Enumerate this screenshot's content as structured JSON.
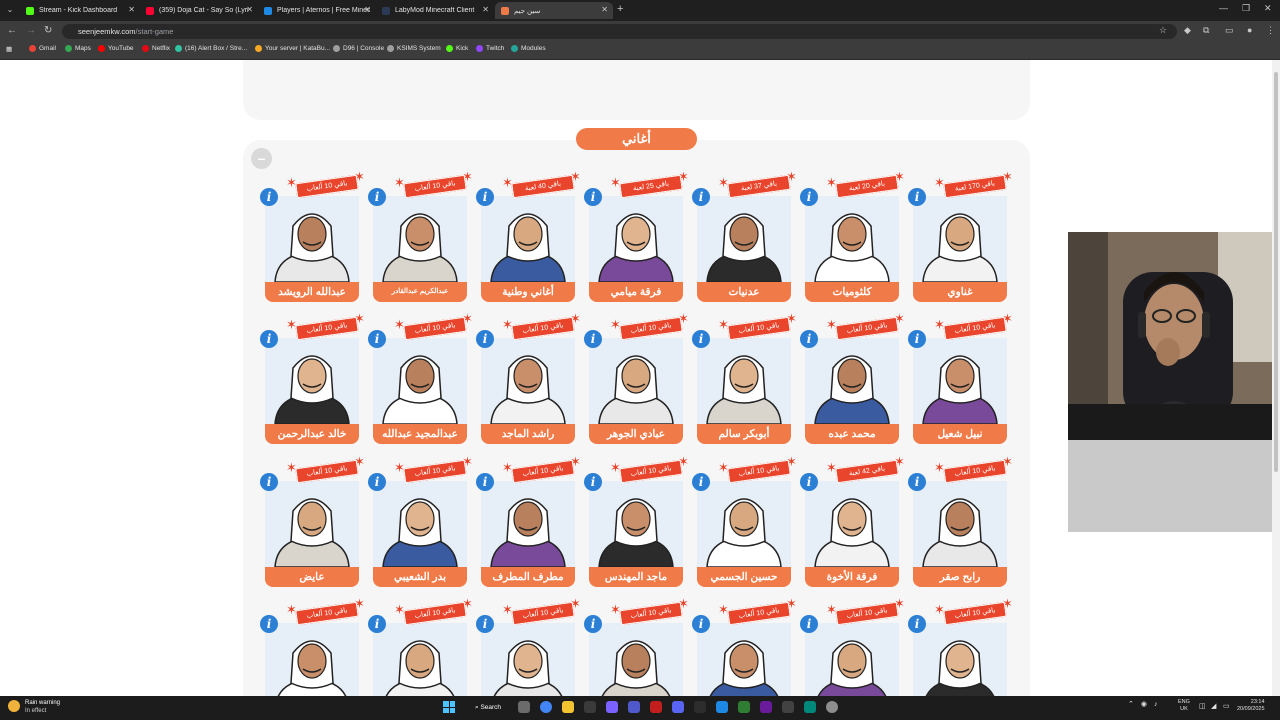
{
  "browser": {
    "tabs": [
      {
        "title": "Stream - Kick Dashboard",
        "fav_color": "#53fc18"
      },
      {
        "title": "(359) Doja Cat - Say So (Lyri",
        "fav_color": "#ff0033"
      },
      {
        "title": "Players | Aternos | Free Minecra",
        "fav_color": "#1e88e5"
      },
      {
        "title": "LabyMod Minecraft Client",
        "fav_color": "#2a3a55"
      },
      {
        "title": "سين جيم",
        "fav_color": "#f07a48"
      }
    ],
    "url_host": "seenjeemkw.com",
    "url_path": "/start-game",
    "bookmarks": [
      {
        "label": "Gmail",
        "color": "#ea4335"
      },
      {
        "label": "Maps",
        "color": "#34a853"
      },
      {
        "label": "YouTube",
        "color": "#ff0000"
      },
      {
        "label": "Netflix",
        "color": "#e50914"
      },
      {
        "label": "(16) Alert Box / Stre...",
        "color": "#31c3a2"
      },
      {
        "label": "Your server | KataBu...",
        "color": "#f9a825"
      },
      {
        "label": "D96 | Console",
        "color": "#9e9e9e"
      },
      {
        "label": "KSIMS System",
        "color": "#9e9e9e"
      },
      {
        "label": "Kick",
        "color": "#53fc18"
      },
      {
        "label": "Twitch",
        "color": "#9146ff"
      },
      {
        "label": "Modules",
        "color": "#26a69a"
      }
    ]
  },
  "page": {
    "section_title": "أغاني",
    "accent_color": "#f07a48",
    "ribbon_color": "#e8452c",
    "info_color": "#2b7fd4",
    "rows": [
      [
        {
          "name": "غناوي",
          "remaining": "باقي 170 لعبة"
        },
        {
          "name": "كلثوميات",
          "remaining": "باقي 20 لعبة"
        },
        {
          "name": "عدنيات",
          "remaining": "باقي 37 لعبة"
        },
        {
          "name": "فرقة ميامي",
          "remaining": "باقي 25 لعبة"
        },
        {
          "name": "أغاني وطنية",
          "remaining": "باقي 40 لعبة"
        },
        {
          "name": "عبدالكريم عبدالقادر",
          "remaining": "باقي 10 ألعاب",
          "small": true
        },
        {
          "name": "عبدالله الرويشد",
          "remaining": "باقي 10 ألعاب"
        }
      ],
      [
        {
          "name": "نبيل شعيل",
          "remaining": "باقي 10 ألعاب"
        },
        {
          "name": "محمد عبده",
          "remaining": "باقي 10 ألعاب"
        },
        {
          "name": "أبوبكر سالم",
          "remaining": "باقي 10 ألعاب"
        },
        {
          "name": "عبادي الجوهر",
          "remaining": "باقي 10 ألعاب"
        },
        {
          "name": "راشد الماجد",
          "remaining": "باقي 10 ألعاب"
        },
        {
          "name": "عبدالمجيد عبدالله",
          "remaining": "باقي 10 ألعاب"
        },
        {
          "name": "خالد عبدالرحمن",
          "remaining": "باقي 10 ألعاب"
        }
      ],
      [
        {
          "name": "رابح صقر",
          "remaining": "باقي 10 ألعاب"
        },
        {
          "name": "فرقة الأخوة",
          "remaining": "باقي 42 لعبة"
        },
        {
          "name": "حسين الجسمي",
          "remaining": "باقي 10 ألعاب"
        },
        {
          "name": "ماجد المهندس",
          "remaining": "باقي 10 ألعاب"
        },
        {
          "name": "مطرف المطرف",
          "remaining": "باقي 10 ألعاب"
        },
        {
          "name": "بدر الشعيبي",
          "remaining": "باقي 10 ألعاب"
        },
        {
          "name": "عايض",
          "remaining": "باقي 10 ألعاب"
        }
      ],
      [
        {
          "name": "",
          "remaining": "باقي 10 ألعاب"
        },
        {
          "name": "",
          "remaining": "باقي 10 ألعاب"
        },
        {
          "name": "",
          "remaining": "باقي 10 ألعاب"
        },
        {
          "name": "",
          "remaining": "باقي 10 ألعاب"
        },
        {
          "name": "",
          "remaining": "باقي 10 ألعاب"
        },
        {
          "name": "",
          "remaining": "باقي 10 ألعاب"
        },
        {
          "name": "",
          "remaining": "باقي 10 ألعاب"
        }
      ]
    ]
  },
  "taskbar": {
    "weather_title": "Rain warning",
    "weather_sub": "In effect",
    "search_label": "Search",
    "lang_top": "ENG",
    "lang_bottom": "UK",
    "time": "23:14",
    "date": "20/09/2025"
  }
}
